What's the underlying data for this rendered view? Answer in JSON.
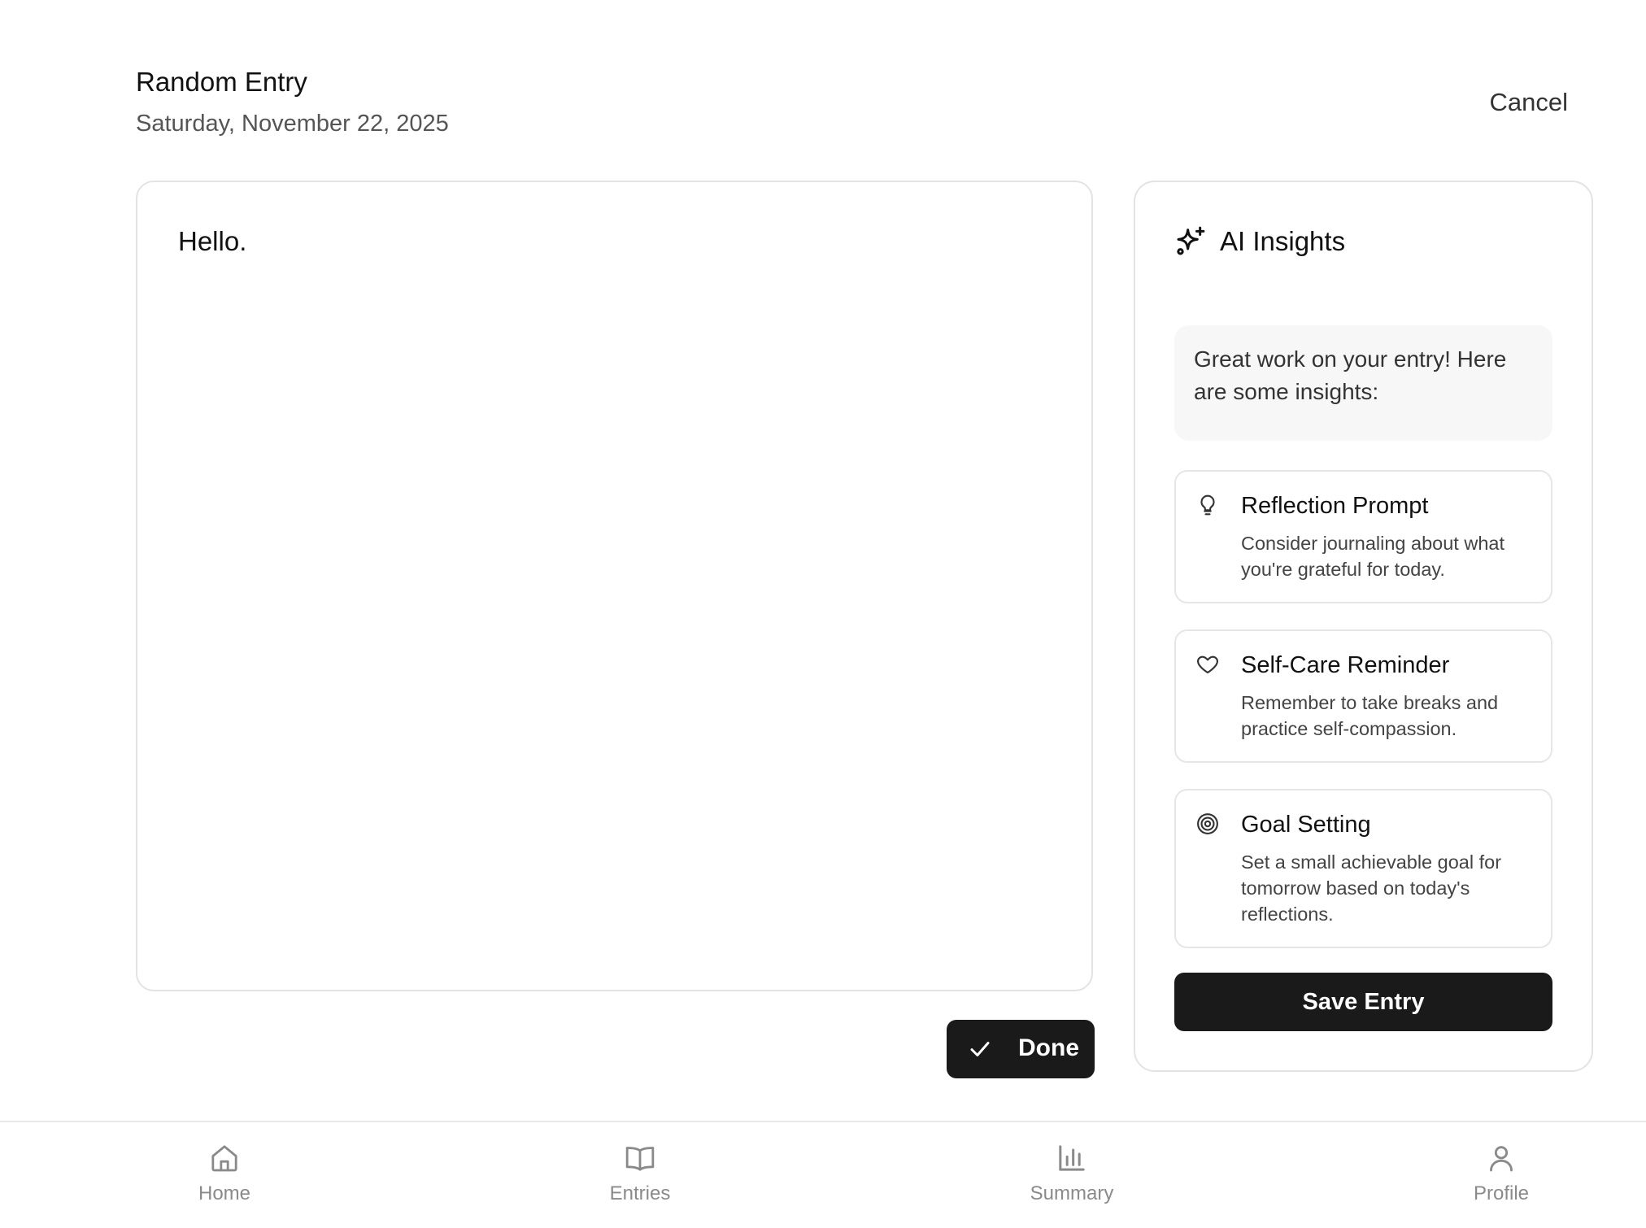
{
  "header": {
    "title": "Random Entry",
    "date": "Saturday, November 22, 2025",
    "cancel_label": "Cancel"
  },
  "editor": {
    "text": "Hello."
  },
  "done_button": {
    "label": "Done",
    "icon": "check-icon"
  },
  "insights": {
    "title": "AI Insights",
    "icon": "sparkles-icon",
    "intro": "Great work on your entry! Here are some insights:",
    "cards": [
      {
        "icon": "lightbulb-icon",
        "title": "Reflection Prompt",
        "body": "Consider journaling about what you're grateful for today."
      },
      {
        "icon": "heart-icon",
        "title": "Self-Care Reminder",
        "body": "Remember to take breaks and practice self-compassion."
      },
      {
        "icon": "target-icon",
        "title": "Goal Setting",
        "body": "Set a small achievable goal for tomorrow based on today's reflections."
      }
    ],
    "save_label": "Save Entry"
  },
  "tabbar": {
    "items": [
      {
        "icon": "home-icon",
        "label": "Home"
      },
      {
        "icon": "book-open-icon",
        "label": "Entries"
      },
      {
        "icon": "bar-chart-icon",
        "label": "Summary"
      },
      {
        "icon": "user-icon",
        "label": "Profile"
      }
    ]
  },
  "colors": {
    "primary_button": "#1a1a1a",
    "muted_text": "#8a8a8a",
    "border": "#e3e3e3",
    "intro_bg": "#f7f7f7"
  }
}
